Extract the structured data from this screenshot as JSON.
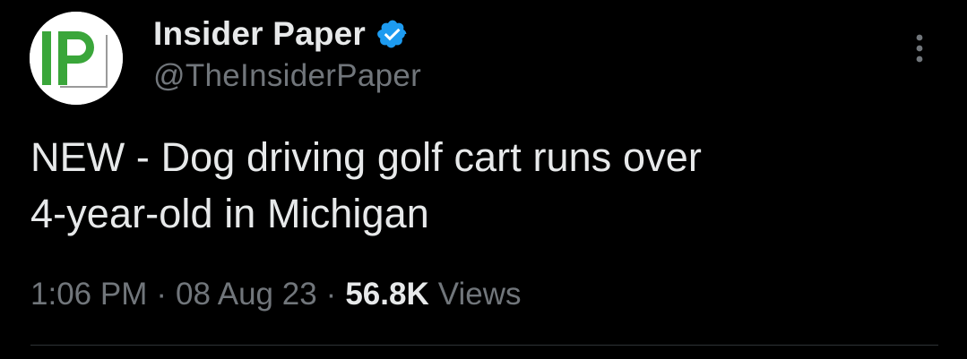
{
  "author": {
    "display_name": "Insider Paper",
    "handle": "@TheInsiderPaper",
    "avatar_text": "IP",
    "verified": true
  },
  "tweet": {
    "text": "NEW - Dog driving golf cart runs over\n4-year-old in Michigan"
  },
  "meta": {
    "time": "1:06 PM",
    "separator": "·",
    "date": "08 Aug 23",
    "views_count": "56.8K",
    "views_label": "Views"
  },
  "icons": {
    "verified": "verified-badge-icon",
    "more": "more-options-icon"
  },
  "colors": {
    "background": "#000000",
    "primary_text": "#e7e9ea",
    "secondary_text": "#71767b",
    "verified_blue": "#1d9bf0",
    "logo_green": "#3aa63a",
    "divider": "#2f3336"
  }
}
